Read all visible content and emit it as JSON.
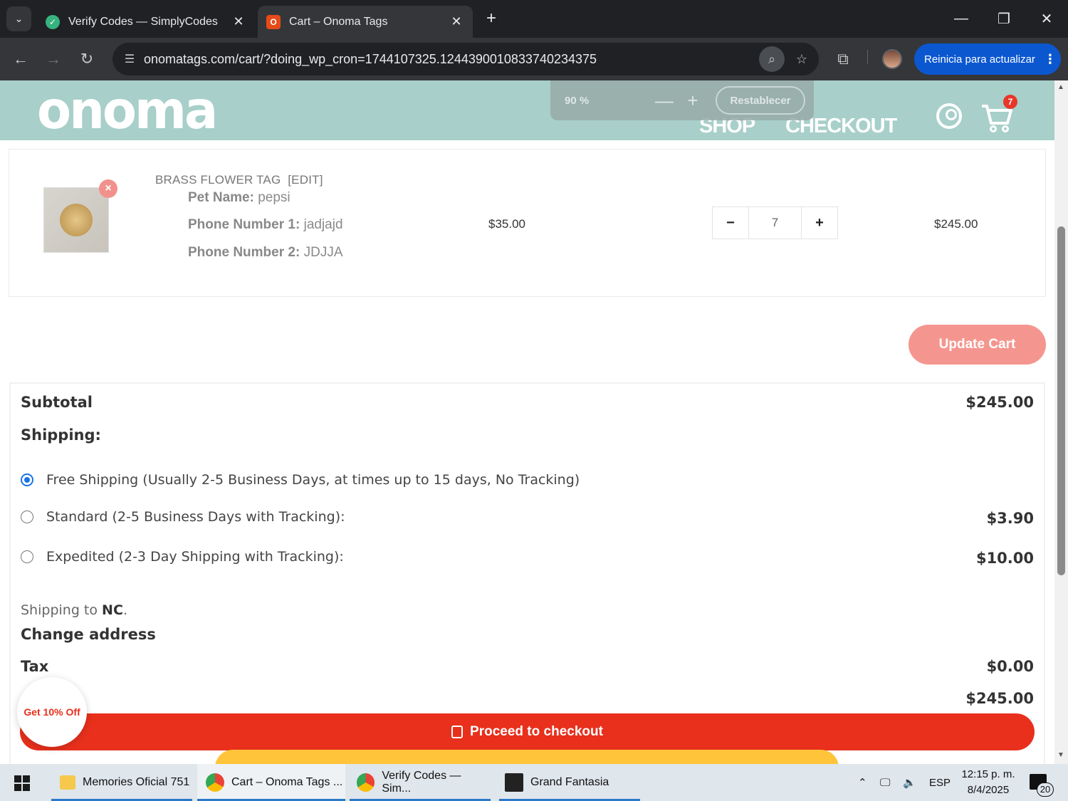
{
  "browser": {
    "tabs": [
      {
        "title": "Verify Codes — SimplyCodes",
        "active": false
      },
      {
        "title": "Cart – Onoma Tags",
        "active": true
      }
    ],
    "url": "onomatags.com/cart/?doing_wp_cron=1744107325.1244390010833740234375",
    "update_button": "Reinicia para actualizar"
  },
  "zoom_popup": {
    "level": "90 %",
    "minus": "—",
    "plus": "+",
    "reset_label": "Restablecer"
  },
  "site": {
    "logo": "onoma",
    "nav": {
      "shop": "SHOP",
      "checkout": "CHECKOUT"
    },
    "cart_count": "7"
  },
  "cart_item": {
    "title": "BRASS FLOWER TAG",
    "edit_label": "[EDIT]",
    "meta": [
      {
        "label": "Pet Name:",
        "value": "pepsi"
      },
      {
        "label": "Phone Number 1:",
        "value": "jadjajd"
      },
      {
        "label": "Phone Number 2:",
        "value": "JDJJA"
      }
    ],
    "unit_price": "$35.00",
    "quantity": "7",
    "qty_minus": "−",
    "qty_plus": "+",
    "line_total": "$245.00",
    "remove_symbol": "×"
  },
  "update_cart_label": "Update Cart",
  "totals": {
    "subtotal_label": "Subtotal",
    "subtotal_value": "$245.00",
    "shipping_label": "Shipping:",
    "shipping_options": [
      {
        "label": "Free Shipping (Usually 2-5 Business Days, at times up to 15 days, No Tracking)",
        "price": "",
        "selected": true
      },
      {
        "label": "Standard (2-5 Business Days with Tracking):",
        "price": "$3.90",
        "selected": false
      },
      {
        "label": "Expedited (2-3 Day Shipping with Tracking):",
        "price": "$10.00",
        "selected": false
      }
    ],
    "shipping_to_prefix": "Shipping to",
    "shipping_to_state": "NC",
    "shipping_to_suffix": ".",
    "change_address": "Change address",
    "tax_label": "Tax",
    "tax_value": "$0.00",
    "total_value": "$245.00"
  },
  "proceed_label": "Proceed to checkout",
  "discount_bubble": "Get 10% Off",
  "taskbar": {
    "items": [
      {
        "label": "Memories Oficial 751",
        "icon": "folder-icon"
      },
      {
        "label": "Cart – Onoma Tags ...",
        "icon": "chrome-icon"
      },
      {
        "label": "Verify Codes — Sim...",
        "icon": "chrome-icon"
      },
      {
        "label": "Grand Fantasia",
        "icon": "game-icon"
      }
    ],
    "language": "ESP",
    "time": "12:15 p. m.",
    "date": "8/4/2025",
    "notifications": "20"
  },
  "colors": {
    "accent_header": "#a8cfca",
    "checkout_red": "#e8301c",
    "update_cart": "#f4968f",
    "chrome_blue": "#0b57d0"
  }
}
